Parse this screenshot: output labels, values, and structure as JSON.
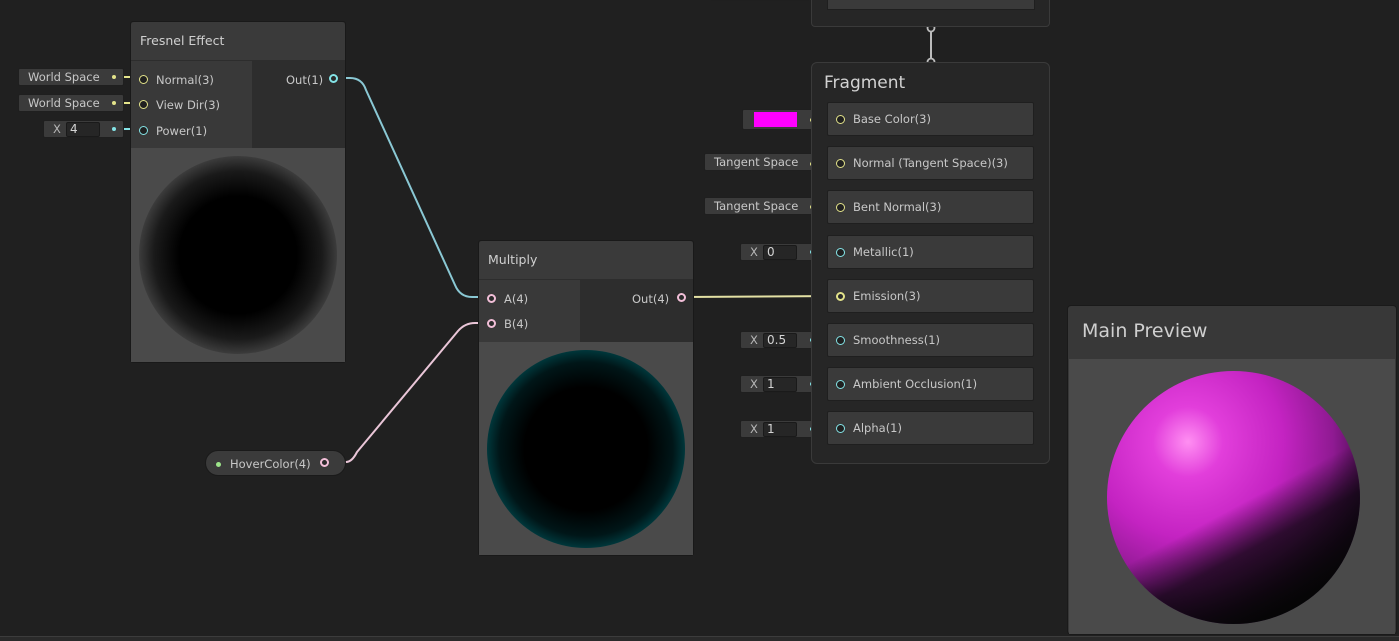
{
  "fresnel_node": {
    "title": "Fresnel Effect",
    "inputs": [
      "Normal(3)",
      "View Dir(3)",
      "Power(1)"
    ],
    "output": "Out(1)",
    "normal_space": "World Space",
    "view_dir_space": "World Space",
    "power_axis": "X",
    "power_value": "4"
  },
  "multiply_node": {
    "title": "Multiply",
    "inputs": [
      "A(4)",
      "B(4)"
    ],
    "output": "Out(4)"
  },
  "property_node": {
    "label": "HoverColor(4)"
  },
  "fragment": {
    "title": "Fragment",
    "base_color_swatch": "#ff00ff",
    "rows": [
      {
        "label": "Base Color(3)"
      },
      {
        "label": "Normal (Tangent Space)(3)",
        "chip": "Tangent Space"
      },
      {
        "label": "Bent Normal(3)",
        "chip": "Tangent Space"
      },
      {
        "label": "Metallic(1)",
        "axis": "X",
        "value": "0"
      },
      {
        "label": "Emission(3)"
      },
      {
        "label": "Smoothness(1)",
        "axis": "X",
        "value": "0.5"
      },
      {
        "label": "Ambient Occlusion(1)",
        "axis": "X",
        "value": "1"
      },
      {
        "label": "Alpha(1)",
        "axis": "X",
        "value": "1"
      }
    ]
  },
  "main_preview": {
    "title": "Main Preview"
  },
  "colors": {
    "vector3_port": "#e3e38a",
    "vector1_port": "#84e4e7",
    "vector4_port": "#f2bfd8",
    "property_port": "#9de58a",
    "emission_cyan": "#00c8d2",
    "base_magenta": "#ff00ff"
  }
}
